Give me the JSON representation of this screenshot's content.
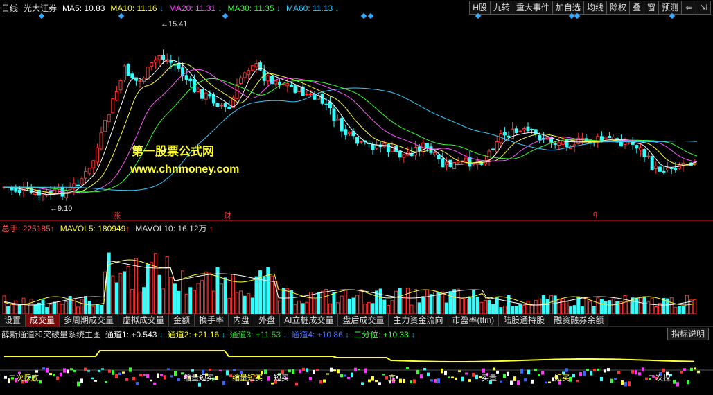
{
  "header": {
    "period": "日线",
    "stock": "光大证券",
    "ma5": {
      "label": "MA5:",
      "value": "10.83",
      "color": "#ffffff"
    },
    "ma10": {
      "label": "MA10:",
      "value": "11.16",
      "color": "#ffff33"
    },
    "ma20": {
      "label": "MA20:",
      "value": "11.31",
      "color": "#ff55ff"
    },
    "ma30": {
      "label": "MA30:",
      "value": "11.35",
      "color": "#33ff33"
    },
    "ma60": {
      "label": "MA60:",
      "value": "11.13",
      "color": "#33ccff"
    },
    "arrow_down": "↓"
  },
  "toolbar": {
    "h_share": "H股",
    "nine_turn": "九转",
    "major_events": "重大事件",
    "add_watch": "加自选",
    "avg_line": "均线",
    "ex_right": "除权",
    "overlay": "叠",
    "window": "窗",
    "forecast": "预测"
  },
  "chart_labels": {
    "high_price": "15.41",
    "low_price": "9.10",
    "watermark_title": "第一股票公式网",
    "watermark_url": "www.chnmoney.com",
    "marker_zhang": "涨",
    "marker_cai": "财",
    "marker_q": "q"
  },
  "volume_header": {
    "total": {
      "label": "总手:",
      "value": "225185",
      "arrow": "↑"
    },
    "mavol5": {
      "label": "MAVOL5:",
      "value": "180949",
      "arrow": "↑"
    },
    "mavol10": {
      "label": "MAVOL10:",
      "value": "16.12万",
      "arrow": "↑"
    }
  },
  "tabs": [
    "设置",
    "成交量",
    "多周期成交量",
    "虚拟成交量",
    "金额",
    "换手率",
    "内盘",
    "外盘",
    "AI立桩成交量",
    "盘后成交量",
    "主力资金流向",
    "市盈率(ttm)",
    "陆股通持股",
    "融资融券余额"
  ],
  "active_tab": "成交量",
  "indicator": {
    "name": "薛斯通道和突破量系统主图",
    "ch1": {
      "label": "通道1:",
      "value": "+0.543",
      "arrow": "↓",
      "color": "#ffffff"
    },
    "ch2": {
      "label": "通道2:",
      "value": "+21.16",
      "arrow": "↓",
      "color": "#ffff33"
    },
    "ch3": {
      "label": "通道3:",
      "value": "+11.53",
      "arrow": "↓",
      "color": "#33cc33"
    },
    "ch4": {
      "label": "通道4:",
      "value": "+10.86",
      "arrow": "↓",
      "color": "#5577ff"
    },
    "half": {
      "label": "二分位:",
      "value": "+10.33",
      "arrow": "↓",
      "color": "#33ff33"
    },
    "explain_button": "指标说明"
  },
  "bottom_labels": [
    "二次探底",
    "缩量短买",
    "缩量短买",
    "短买",
    "底",
    "买量",
    "短买",
    "二次探"
  ],
  "colors": {
    "up": "#ff3333",
    "down": "#33ffff",
    "border": "#7a0a0a",
    "bg": "#000000"
  },
  "chart_data": {
    "type": "candlestick",
    "y_high": 15.41,
    "y_low": 9.1,
    "volume_last": 225185
  }
}
